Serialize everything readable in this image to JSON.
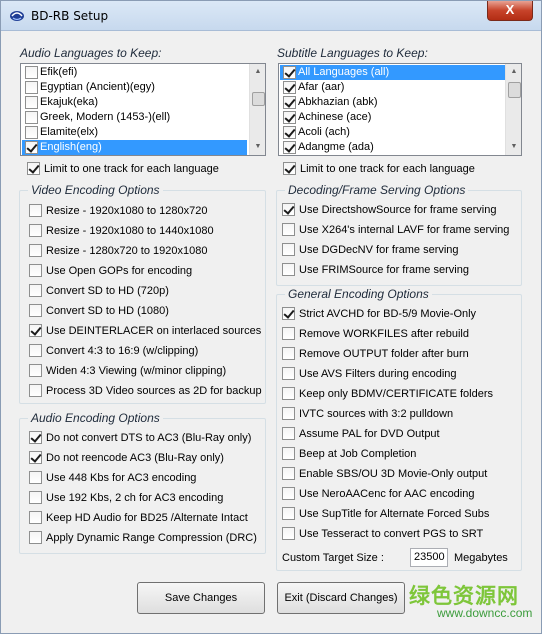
{
  "window": {
    "title": "BD-RB Setup",
    "close_label": "X"
  },
  "audio_languages": {
    "label": "Audio Languages to Keep:",
    "items": [
      {
        "label": "Efik(efi)",
        "checked": false,
        "selected": false
      },
      {
        "label": "Egyptian (Ancient)(egy)",
        "checked": false,
        "selected": false
      },
      {
        "label": "Ekajuk(eka)",
        "checked": false,
        "selected": false
      },
      {
        "label": "Greek, Modern (1453-)(ell)",
        "checked": false,
        "selected": false
      },
      {
        "label": "Elamite(elx)",
        "checked": false,
        "selected": false
      },
      {
        "label": "English(eng)",
        "checked": true,
        "selected": true
      }
    ],
    "limit_label": "Limit to one track for each language",
    "limit_checked": true
  },
  "subtitle_languages": {
    "label": "Subtitle Languages to Keep:",
    "items": [
      {
        "label": "All Languages (all)",
        "checked": true,
        "selected": true
      },
      {
        "label": "Afar (aar)",
        "checked": true,
        "selected": false
      },
      {
        "label": "Abkhazian (abk)",
        "checked": true,
        "selected": false
      },
      {
        "label": "Achinese (ace)",
        "checked": true,
        "selected": false
      },
      {
        "label": "Acoli (ach)",
        "checked": true,
        "selected": false
      },
      {
        "label": "Adangme (ada)",
        "checked": true,
        "selected": false
      }
    ],
    "limit_label": "Limit to one track for each language",
    "limit_checked": true
  },
  "video_encoding": {
    "label": "Video Encoding Options",
    "options": [
      {
        "label": "Resize  - 1920x1080 to 1280x720",
        "checked": false
      },
      {
        "label": "Resize  - 1920x1080 to 1440x1080",
        "checked": false
      },
      {
        "label": "Resize  - 1280x720 to 1920x1080",
        "checked": false
      },
      {
        "label": "Use Open GOPs for encoding",
        "checked": false
      },
      {
        "label": "Convert SD to HD (720p)",
        "checked": false
      },
      {
        "label": "Convert SD to HD (1080)",
        "checked": false
      },
      {
        "label": "Use DEINTERLACER on interlaced sources",
        "checked": true
      },
      {
        "label": "Convert 4:3 to 16:9 (w/clipping)",
        "checked": false
      },
      {
        "label": "Widen 4:3 Viewing (w/minor clipping)",
        "checked": false
      },
      {
        "label": "Process 3D Video sources as 2D for backup",
        "checked": false
      }
    ]
  },
  "audio_encoding": {
    "label": "Audio Encoding Options",
    "options": [
      {
        "label": "Do not convert DTS to AC3  (Blu-Ray only)",
        "checked": true
      },
      {
        "label": "Do not reencode AC3  (Blu-Ray only)",
        "checked": true
      },
      {
        "label": "Use 448 Kbs for AC3 encoding",
        "checked": false
      },
      {
        "label": "Use 192 Kbs, 2 ch for AC3 encoding",
        "checked": false
      },
      {
        "label": "Keep HD Audio for BD25 /Alternate Intact",
        "checked": false
      },
      {
        "label": "Apply Dynamic Range Compression (DRC)",
        "checked": false
      }
    ]
  },
  "decoding": {
    "label": "Decoding/Frame Serving Options",
    "options": [
      {
        "label": "Use DirectshowSource for frame serving",
        "checked": true
      },
      {
        "label": "Use X264's internal LAVF for frame serving",
        "checked": false
      },
      {
        "label": "Use DGDecNV for frame serving",
        "checked": false
      },
      {
        "label": "Use FRIMSource for frame serving",
        "checked": false
      }
    ]
  },
  "general_encoding": {
    "label": "General Encoding Options",
    "options": [
      {
        "label": "Strict AVCHD for BD-5/9 Movie-Only",
        "checked": true
      },
      {
        "label": "Remove WORKFILES after rebuild",
        "checked": false
      },
      {
        "label": "Remove OUTPUT folder after burn",
        "checked": false
      },
      {
        "label": "Use AVS Filters during encoding",
        "checked": false
      },
      {
        "label": "Keep only BDMV/CERTIFICATE folders",
        "checked": false
      },
      {
        "label": "IVTC sources with 3:2 pulldown",
        "checked": false
      },
      {
        "label": "Assume PAL for DVD Output",
        "checked": false
      },
      {
        "label": "Beep at Job Completion",
        "checked": false
      },
      {
        "label": "Enable SBS/OU 3D Movie-Only output",
        "checked": false
      },
      {
        "label": "Use NeroAACenc for AAC encoding",
        "checked": false
      },
      {
        "label": "Use SupTitle for Alternate Forced Subs",
        "checked": false
      },
      {
        "label": "Use Tesseract to convert PGS to SRT",
        "checked": false
      }
    ],
    "custom_size_label": "Custom Target Size :",
    "custom_size_value": "23500",
    "custom_size_unit": "Megabytes"
  },
  "buttons": {
    "save_label": "Save Changes",
    "exit_label": "Exit (Discard Changes)"
  },
  "watermark": {
    "line1": "绿色资源网",
    "line2": "www.downcc.com"
  }
}
